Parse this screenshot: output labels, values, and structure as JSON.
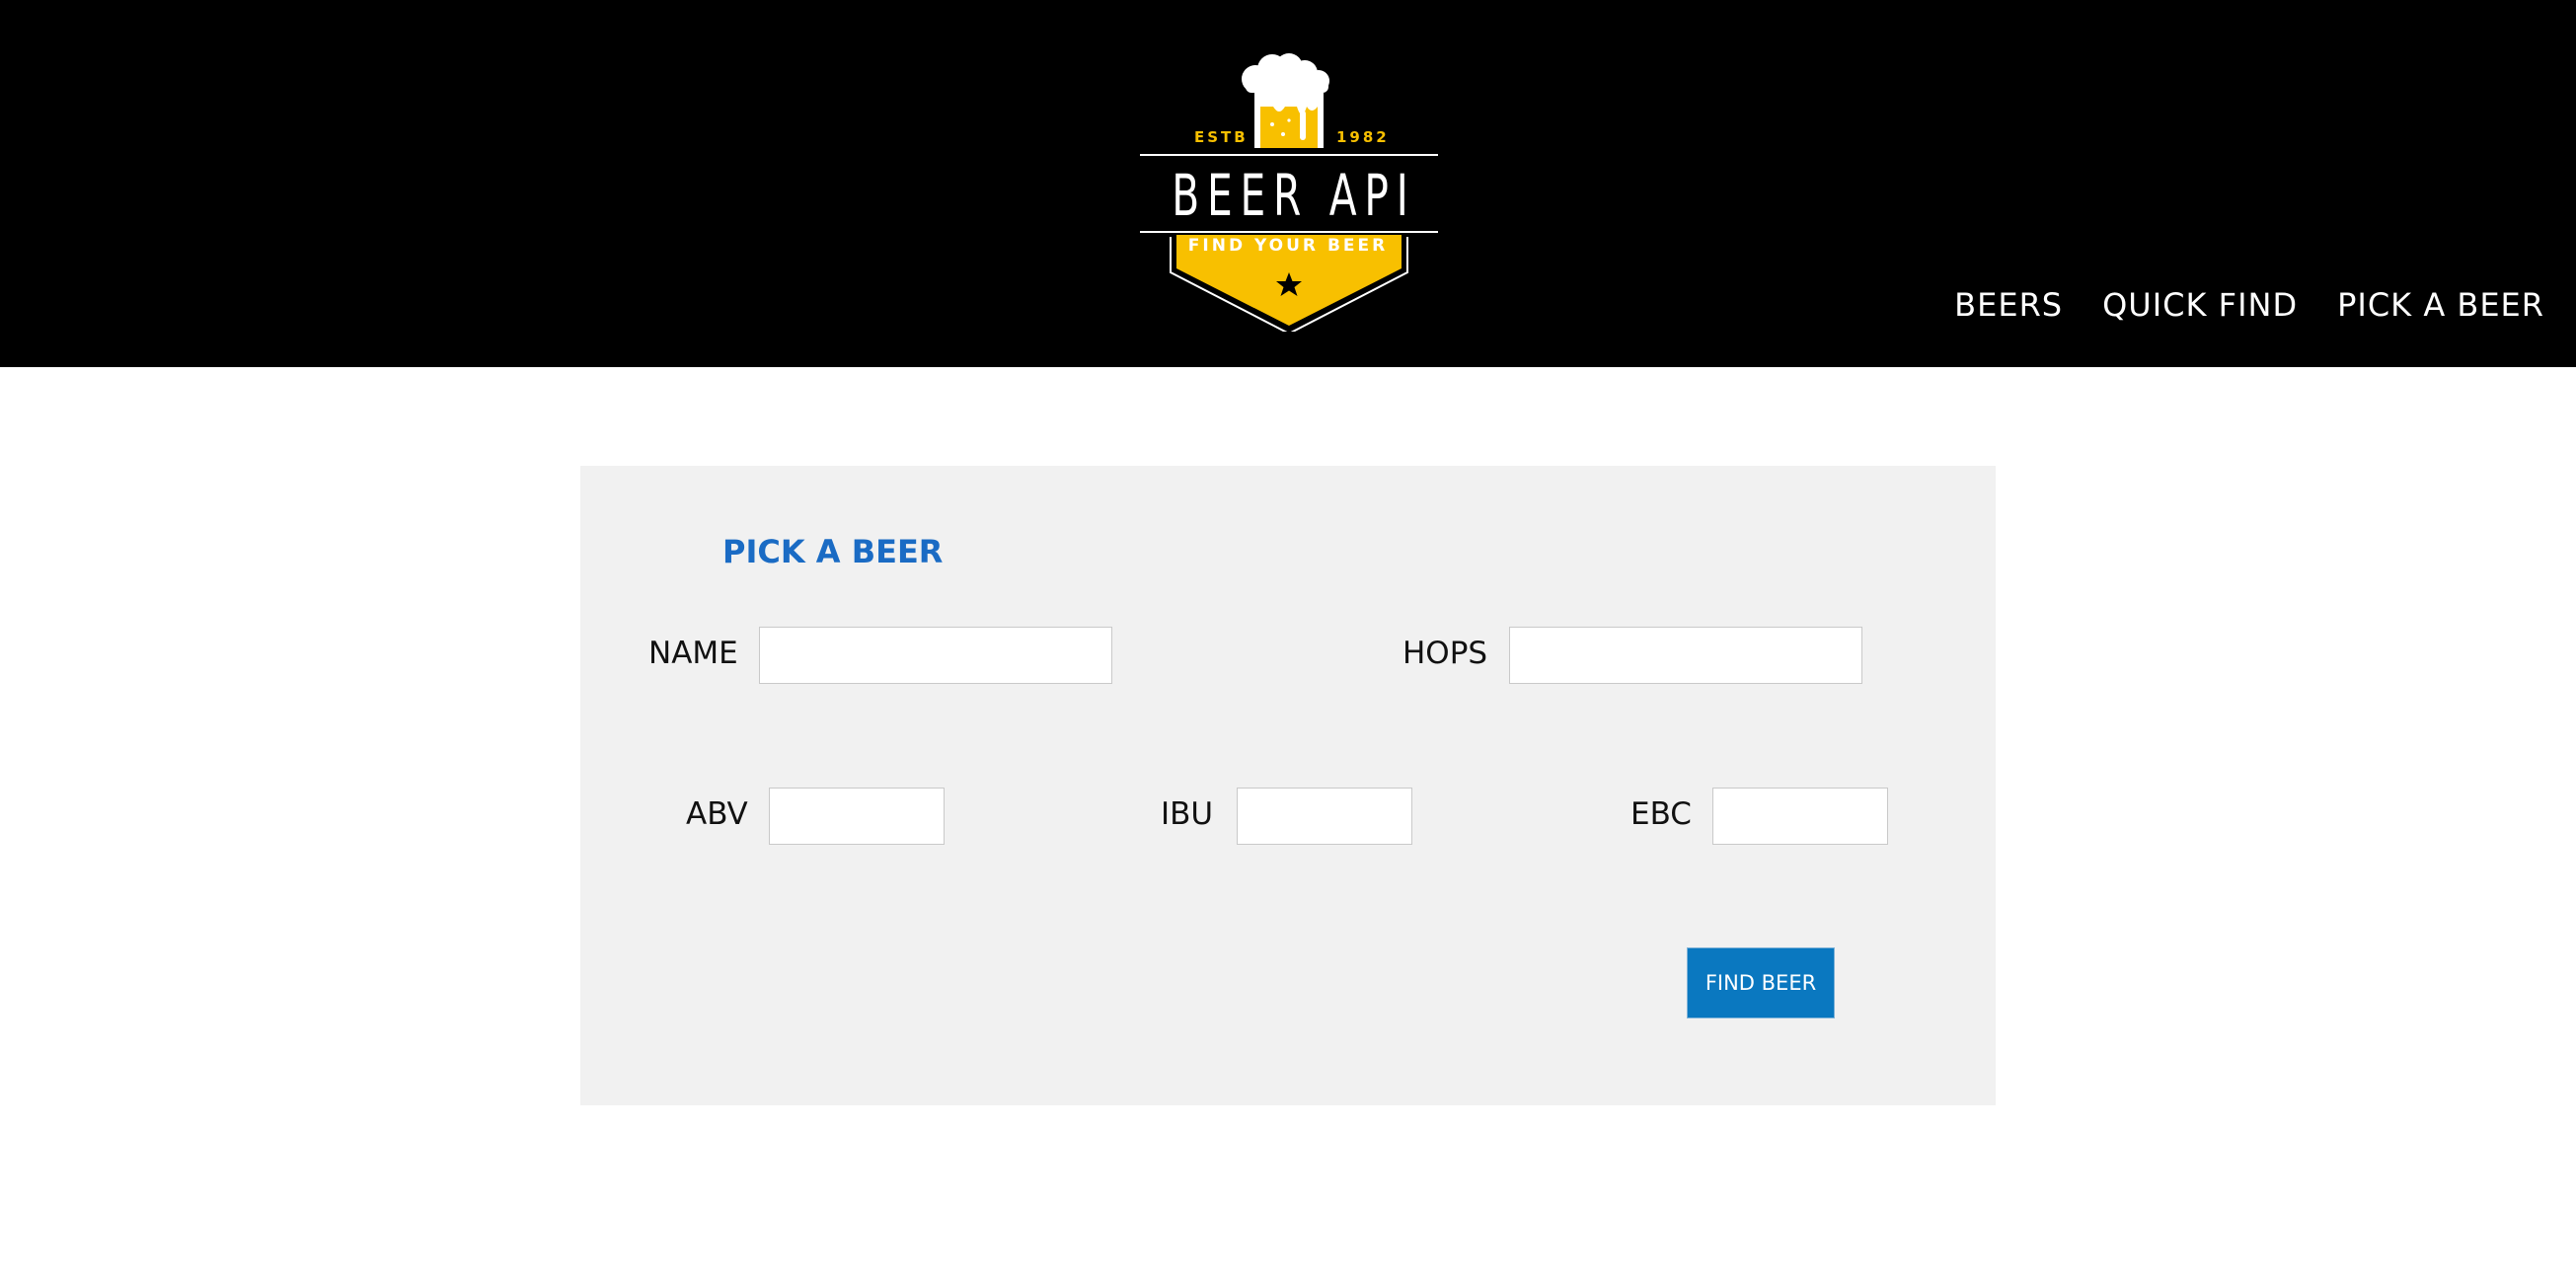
{
  "logo": {
    "estb": "ESTB",
    "year": "1982",
    "brand": "BEER API",
    "tagline": "FIND YOUR BEER"
  },
  "nav": {
    "items": [
      "BEERS",
      "QUICK FIND",
      "PICK A BEER"
    ]
  },
  "form": {
    "title": "PICK A BEER",
    "fields": {
      "name": {
        "label": "NAME",
        "value": ""
      },
      "hops": {
        "label": "HOPS",
        "value": ""
      },
      "abv": {
        "label": "ABV",
        "value": ""
      },
      "ibu": {
        "label": "IBU",
        "value": ""
      },
      "ebc": {
        "label": "EBC",
        "value": ""
      }
    },
    "submit_label": "FIND BEER"
  },
  "colors": {
    "header_bg": "#000000",
    "accent_yellow": "#f8c000",
    "title_blue": "#1a6bc4",
    "button_blue": "#0a78c0",
    "panel_bg": "#f1f1f1"
  }
}
